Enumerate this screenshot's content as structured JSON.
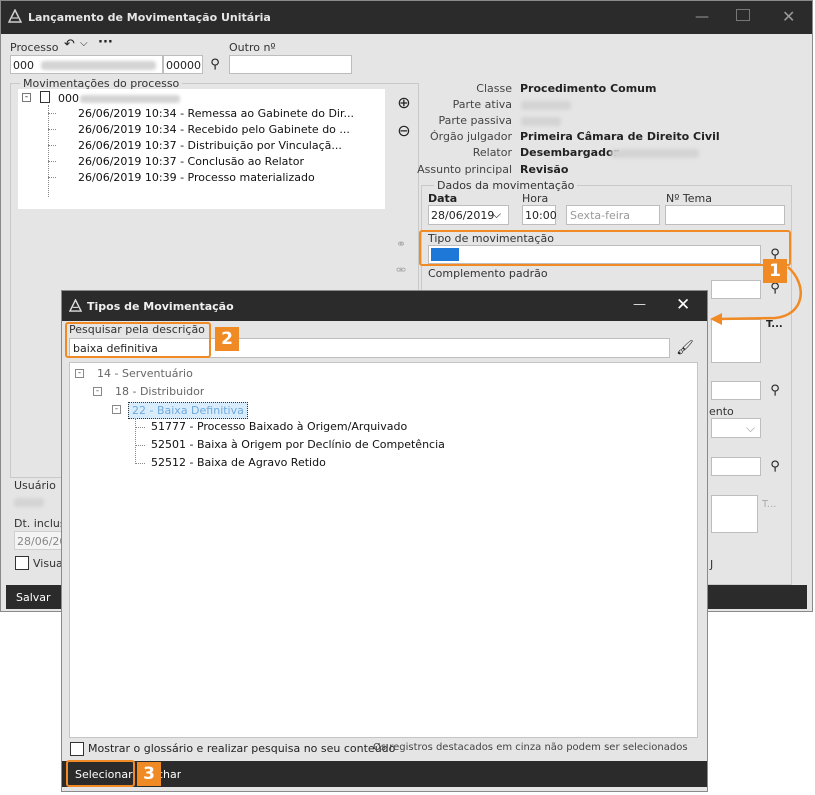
{
  "main": {
    "title": "Lançamento de Movimentação Unitária",
    "processo_label": "Processo",
    "processo_prefix": "000",
    "processo_suffix": "00000",
    "outro_label": "Outro nº",
    "movs_title": "Movimentações do processo",
    "root_node": "000",
    "movements": [
      "26/06/2019 10:34 - Remessa ao Gabinete do Dir...",
      "26/06/2019 10:34 - Recebido pelo Gabinete do ...",
      "26/06/2019 10:37 - Distribuição por Vinculaçã...",
      "26/06/2019 10:37 - Conclusão ao Relator",
      "26/06/2019 10:39 - Processo materializado"
    ],
    "info": {
      "classe_label": "Classe",
      "classe_value": "Procedimento Comum",
      "ativa_label": "Parte ativa",
      "passiva_label": "Parte passiva",
      "orgao_label": "Órgão julgador",
      "orgao_value": "Primeira Câmara de Direito Civil",
      "relator_label": "Relator",
      "relator_value": "Desembargador",
      "assunto_label": "Assunto principal",
      "assunto_value": "Revisão"
    },
    "dados": {
      "legend": "Dados da movimentação",
      "data_label": "Data",
      "data_value": "28/06/2019",
      "hora_label": "Hora",
      "hora_value": "10:00",
      "dia_value": "Sexta-feira",
      "tema_label": "Nº Tema",
      "tipo_label": "Tipo de movimentação",
      "complemento_label": "Complemento padrão",
      "mento_text": "ento",
      "j_text": "J",
      "dots_text": "T...",
      "tdot_text": "T..."
    },
    "usuario_label": "Usuário",
    "dt_inclusao_label": "Dt. inclus",
    "dt_inclusao_value": "28/06/20",
    "visua_label": "Visua",
    "salvar_label": "Salvar"
  },
  "dialog": {
    "title": "Tipos de Movimentação",
    "search_label": "Pesquisar pela descrição",
    "search_value": "baixa definitiva",
    "tree": {
      "n1": "14 - Serventuário",
      "n2": "18 - Distribuidor",
      "n3": "22 - Baixa Definitiva",
      "leaves": [
        "51777 - Processo Baixado à Origem/Arquivado",
        "52501 - Baixa à Origem por Declínio de Competência",
        "52512 - Baixa de Agravo Retido"
      ]
    },
    "glossary_label": "Mostrar o glossário e realizar pesquisa no seu conteúdo",
    "gray_note": "Os registros destacados em cinza não podem ser selecionados",
    "selecionar_label": "Selecionar",
    "fechar_label": "char"
  },
  "badges": {
    "b1": "1",
    "b2": "2",
    "b3": "3"
  },
  "colors": {
    "accent": "#f08a24",
    "titlebar": "#2b2b2b",
    "selection": "#1e78d7"
  }
}
